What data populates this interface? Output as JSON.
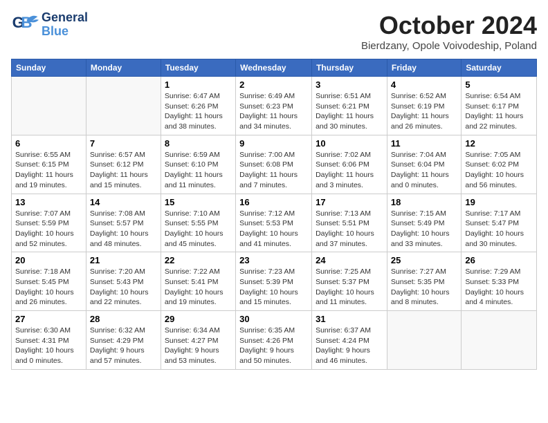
{
  "header": {
    "logo": {
      "general": "General",
      "blue": "Blue"
    },
    "title": "October 2024",
    "subtitle": "Bierdzany, Opole Voivodeship, Poland"
  },
  "weekdays": [
    "Sunday",
    "Monday",
    "Tuesday",
    "Wednesday",
    "Thursday",
    "Friday",
    "Saturday"
  ],
  "weeks": [
    [
      {
        "day": "",
        "info": ""
      },
      {
        "day": "",
        "info": ""
      },
      {
        "day": "1",
        "info": "Sunrise: 6:47 AM\nSunset: 6:26 PM\nDaylight: 11 hours and 38 minutes."
      },
      {
        "day": "2",
        "info": "Sunrise: 6:49 AM\nSunset: 6:23 PM\nDaylight: 11 hours and 34 minutes."
      },
      {
        "day": "3",
        "info": "Sunrise: 6:51 AM\nSunset: 6:21 PM\nDaylight: 11 hours and 30 minutes."
      },
      {
        "day": "4",
        "info": "Sunrise: 6:52 AM\nSunset: 6:19 PM\nDaylight: 11 hours and 26 minutes."
      },
      {
        "day": "5",
        "info": "Sunrise: 6:54 AM\nSunset: 6:17 PM\nDaylight: 11 hours and 22 minutes."
      }
    ],
    [
      {
        "day": "6",
        "info": "Sunrise: 6:55 AM\nSunset: 6:15 PM\nDaylight: 11 hours and 19 minutes."
      },
      {
        "day": "7",
        "info": "Sunrise: 6:57 AM\nSunset: 6:12 PM\nDaylight: 11 hours and 15 minutes."
      },
      {
        "day": "8",
        "info": "Sunrise: 6:59 AM\nSunset: 6:10 PM\nDaylight: 11 hours and 11 minutes."
      },
      {
        "day": "9",
        "info": "Sunrise: 7:00 AM\nSunset: 6:08 PM\nDaylight: 11 hours and 7 minutes."
      },
      {
        "day": "10",
        "info": "Sunrise: 7:02 AM\nSunset: 6:06 PM\nDaylight: 11 hours and 3 minutes."
      },
      {
        "day": "11",
        "info": "Sunrise: 7:04 AM\nSunset: 6:04 PM\nDaylight: 11 hours and 0 minutes."
      },
      {
        "day": "12",
        "info": "Sunrise: 7:05 AM\nSunset: 6:02 PM\nDaylight: 10 hours and 56 minutes."
      }
    ],
    [
      {
        "day": "13",
        "info": "Sunrise: 7:07 AM\nSunset: 5:59 PM\nDaylight: 10 hours and 52 minutes."
      },
      {
        "day": "14",
        "info": "Sunrise: 7:08 AM\nSunset: 5:57 PM\nDaylight: 10 hours and 48 minutes."
      },
      {
        "day": "15",
        "info": "Sunrise: 7:10 AM\nSunset: 5:55 PM\nDaylight: 10 hours and 45 minutes."
      },
      {
        "day": "16",
        "info": "Sunrise: 7:12 AM\nSunset: 5:53 PM\nDaylight: 10 hours and 41 minutes."
      },
      {
        "day": "17",
        "info": "Sunrise: 7:13 AM\nSunset: 5:51 PM\nDaylight: 10 hours and 37 minutes."
      },
      {
        "day": "18",
        "info": "Sunrise: 7:15 AM\nSunset: 5:49 PM\nDaylight: 10 hours and 33 minutes."
      },
      {
        "day": "19",
        "info": "Sunrise: 7:17 AM\nSunset: 5:47 PM\nDaylight: 10 hours and 30 minutes."
      }
    ],
    [
      {
        "day": "20",
        "info": "Sunrise: 7:18 AM\nSunset: 5:45 PM\nDaylight: 10 hours and 26 minutes."
      },
      {
        "day": "21",
        "info": "Sunrise: 7:20 AM\nSunset: 5:43 PM\nDaylight: 10 hours and 22 minutes."
      },
      {
        "day": "22",
        "info": "Sunrise: 7:22 AM\nSunset: 5:41 PM\nDaylight: 10 hours and 19 minutes."
      },
      {
        "day": "23",
        "info": "Sunrise: 7:23 AM\nSunset: 5:39 PM\nDaylight: 10 hours and 15 minutes."
      },
      {
        "day": "24",
        "info": "Sunrise: 7:25 AM\nSunset: 5:37 PM\nDaylight: 10 hours and 11 minutes."
      },
      {
        "day": "25",
        "info": "Sunrise: 7:27 AM\nSunset: 5:35 PM\nDaylight: 10 hours and 8 minutes."
      },
      {
        "day": "26",
        "info": "Sunrise: 7:29 AM\nSunset: 5:33 PM\nDaylight: 10 hours and 4 minutes."
      }
    ],
    [
      {
        "day": "27",
        "info": "Sunrise: 6:30 AM\nSunset: 4:31 PM\nDaylight: 10 hours and 0 minutes."
      },
      {
        "day": "28",
        "info": "Sunrise: 6:32 AM\nSunset: 4:29 PM\nDaylight: 9 hours and 57 minutes."
      },
      {
        "day": "29",
        "info": "Sunrise: 6:34 AM\nSunset: 4:27 PM\nDaylight: 9 hours and 53 minutes."
      },
      {
        "day": "30",
        "info": "Sunrise: 6:35 AM\nSunset: 4:26 PM\nDaylight: 9 hours and 50 minutes."
      },
      {
        "day": "31",
        "info": "Sunrise: 6:37 AM\nSunset: 4:24 PM\nDaylight: 9 hours and 46 minutes."
      },
      {
        "day": "",
        "info": ""
      },
      {
        "day": "",
        "info": ""
      }
    ]
  ]
}
